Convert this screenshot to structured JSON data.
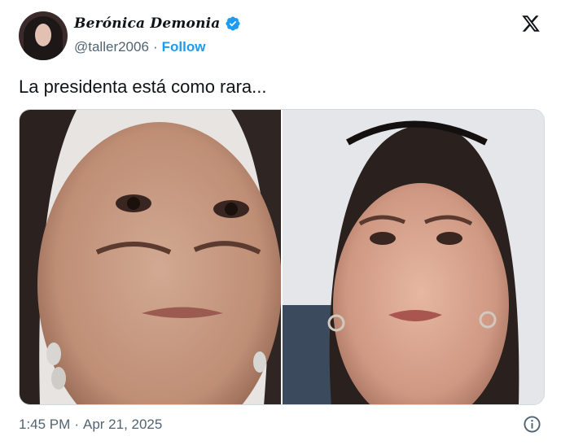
{
  "author": {
    "display_name": "Berónica Demonia",
    "handle": "@taller2006",
    "separator": "·",
    "follow_label": "Follow"
  },
  "tweet": {
    "text": "La presidenta está como rara...",
    "time": "1:45 PM",
    "separator": "·",
    "date": "Apr 21, 2025"
  },
  "icons": {
    "verified": "verified-badge-icon",
    "logo": "x-logo-icon",
    "info": "info-icon"
  },
  "colors": {
    "accent": "#1d9bf0",
    "text": "#0f1419",
    "secondary": "#536471",
    "border": "#cfd9de"
  }
}
